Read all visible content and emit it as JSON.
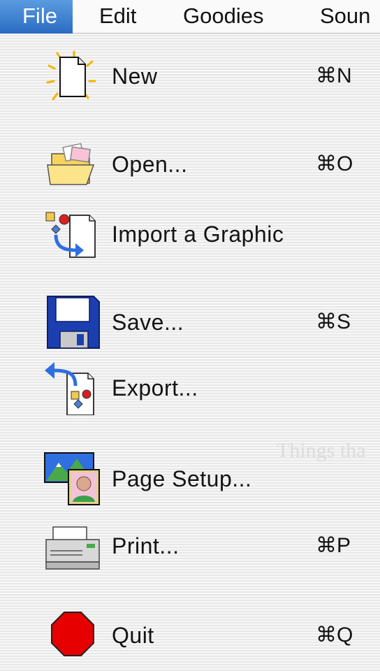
{
  "menubar": {
    "items": [
      {
        "label": "File",
        "active": true
      },
      {
        "label": "Edit"
      },
      {
        "label": "Goodies"
      },
      {
        "label": "Soun"
      }
    ]
  },
  "file_menu": {
    "items": [
      {
        "label": "New",
        "shortcut": "⌘N",
        "icon": "new-document-icon"
      },
      {
        "label": "Open...",
        "shortcut": "⌘O",
        "icon": "open-folder-icon"
      },
      {
        "label": "Import a Graphic",
        "shortcut": "",
        "icon": "import-graphic-icon"
      },
      {
        "label": "Save...",
        "shortcut": "⌘S",
        "icon": "floppy-disk-icon"
      },
      {
        "label": "Export...",
        "shortcut": "",
        "icon": "export-icon"
      },
      {
        "label": "Page Setup...",
        "shortcut": "",
        "icon": "page-setup-icon"
      },
      {
        "label": "Print...",
        "shortcut": "⌘P",
        "icon": "printer-icon"
      },
      {
        "label": "Quit",
        "shortcut": "⌘Q",
        "icon": "stop-sign-icon"
      }
    ]
  },
  "background": {
    "ghost_text": "Things tha"
  },
  "colors": {
    "menubar_active": "#2a6cc4",
    "menu_background": "#f3f3f3"
  }
}
